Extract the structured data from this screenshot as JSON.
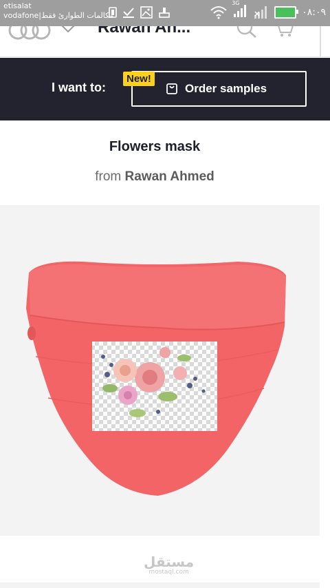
{
  "status_bar": {
    "carrier_1": "etisalat",
    "carrier_2": "vodafone|مكالمات الطوارئ فقط",
    "network": "3G",
    "time": "٠٨:٠٩"
  },
  "header": {
    "store_title": "Rawan An..."
  },
  "action_bar": {
    "label": "I want to:",
    "badge": "New!",
    "button_label": "Order samples"
  },
  "product": {
    "title": "Flowers mask",
    "from_prefix": "from",
    "author": "Rawan Ahmed"
  },
  "colors": {
    "mask": "#f26466",
    "dark_bar": "#23232f",
    "badge": "#fbd11d"
  },
  "watermark": {
    "arabic": "مستقل",
    "latin": "mostaql.com"
  }
}
